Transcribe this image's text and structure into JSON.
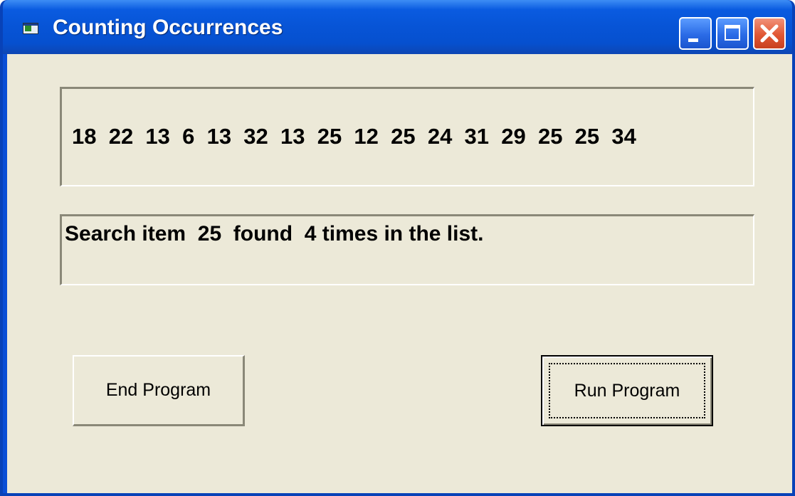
{
  "window": {
    "title": "Counting Occurrences",
    "icons": {
      "app": "form-icon",
      "minimize": "minimize-icon",
      "maximize": "maximize-icon",
      "close": "close-icon"
    }
  },
  "list_box": {
    "values_text": "18  22  13  6  13  32  13  25  12  25  24  31  29  25  25  34",
    "values": [
      18,
      22,
      13,
      6,
      13,
      32,
      13,
      25,
      12,
      25,
      24,
      31,
      29,
      25,
      25,
      34
    ]
  },
  "result_box": {
    "text": "Search item  25  found  4 times in the list."
  },
  "buttons": {
    "end_label": "End Program",
    "run_label": "Run Program"
  },
  "colors": {
    "titlebar": "#0754d6",
    "client_background": "#ece9d8",
    "close_button": "#e15734"
  }
}
